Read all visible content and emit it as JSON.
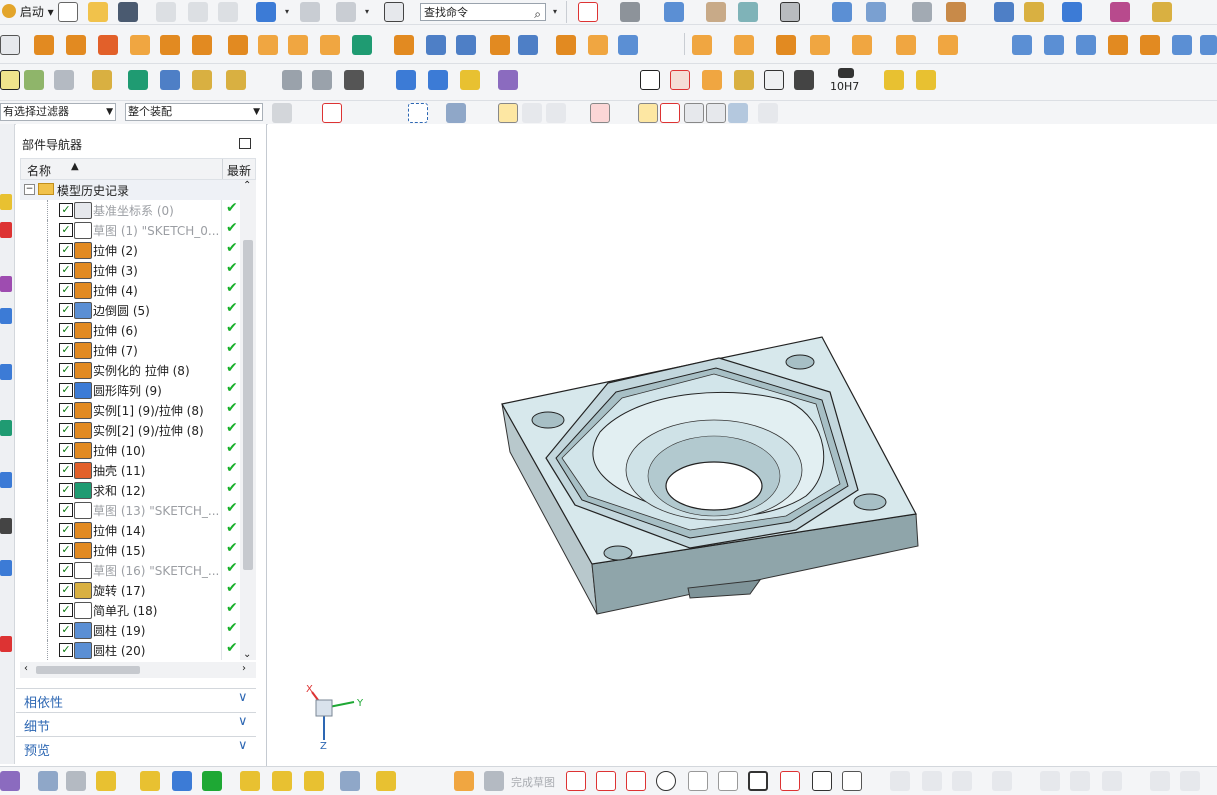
{
  "toolbar": {
    "start_label": "启动",
    "search_value": "查找命令",
    "filter_value": "有选择过滤器",
    "assembly_value": "整个装配",
    "fit_label": "10H7"
  },
  "navigator": {
    "title": "部件导航器",
    "col_name": "名称",
    "col_latest": "最新",
    "root": "模型历史记录",
    "items": [
      {
        "label": "基准坐标系 (0)",
        "gray": true,
        "icon": "datum-csys-icon"
      },
      {
        "label": "草图 (1) \"SKETCH_0...",
        "gray": true,
        "icon": "sketch-icon"
      },
      {
        "label": "拉伸 (2)",
        "gray": false,
        "icon": "extrude-icon"
      },
      {
        "label": "拉伸 (3)",
        "gray": false,
        "icon": "extrude-icon"
      },
      {
        "label": "拉伸 (4)",
        "gray": false,
        "icon": "extrude-icon"
      },
      {
        "label": "边倒圆 (5)",
        "gray": false,
        "icon": "edge-blend-icon"
      },
      {
        "label": "拉伸 (6)",
        "gray": false,
        "icon": "extrude-icon"
      },
      {
        "label": "拉伸 (7)",
        "gray": false,
        "icon": "extrude-icon"
      },
      {
        "label": "实例化的 拉伸 (8)",
        "gray": false,
        "icon": "extrude-icon"
      },
      {
        "label": "圆形阵列 (9)",
        "gray": false,
        "icon": "circular-pattern-icon"
      },
      {
        "label": "实例[1] (9)/拉伸 (8)",
        "gray": false,
        "icon": "extrude-icon"
      },
      {
        "label": "实例[2] (9)/拉伸 (8)",
        "gray": false,
        "icon": "extrude-icon"
      },
      {
        "label": "拉伸 (10)",
        "gray": false,
        "icon": "extrude-icon"
      },
      {
        "label": "抽壳 (11)",
        "gray": false,
        "icon": "shell-icon"
      },
      {
        "label": "求和 (12)",
        "gray": false,
        "icon": "unite-icon"
      },
      {
        "label": "草图 (13) \"SKETCH_...",
        "gray": true,
        "icon": "sketch-icon"
      },
      {
        "label": "拉伸 (14)",
        "gray": false,
        "icon": "extrude-icon"
      },
      {
        "label": "拉伸 (15)",
        "gray": false,
        "icon": "extrude-icon"
      },
      {
        "label": "草图 (16) \"SKETCH_...",
        "gray": true,
        "icon": "sketch-icon"
      },
      {
        "label": "旋转 (17)",
        "gray": false,
        "icon": "revolve-icon"
      },
      {
        "label": "简单孔 (18)",
        "gray": false,
        "icon": "hole-icon"
      },
      {
        "label": "圆柱 (19)",
        "gray": false,
        "icon": "cylinder-icon"
      },
      {
        "label": "圆柱 (20)",
        "gray": false,
        "icon": "cylinder-icon"
      }
    ],
    "panels": [
      "相依性",
      "细节",
      "预览"
    ]
  },
  "triad": {
    "x": "X",
    "y": "Y",
    "z": "Z"
  },
  "bottom": {
    "finish_sketch": "完成草图"
  },
  "colors": {
    "extrude": "#e28a21",
    "check_ok": "#17b02a",
    "panel_text": "#2d67b3",
    "model_top": "#c9dfe4",
    "model_side": "#93a9ae"
  }
}
